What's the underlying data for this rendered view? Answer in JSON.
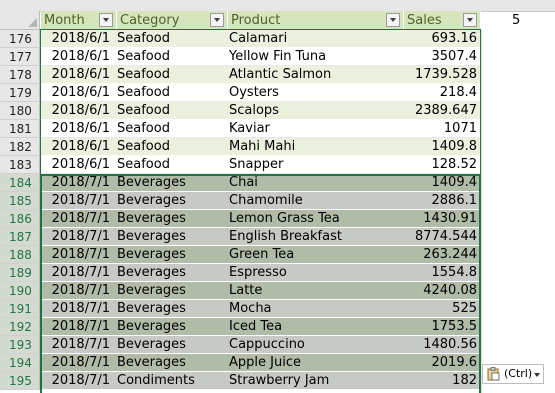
{
  "headers": [
    {
      "label": "Month"
    },
    {
      "label": "Category"
    },
    {
      "label": "Product"
    },
    {
      "label": "Sales"
    }
  ],
  "outside_cell": "5",
  "paste_options_label": "(Ctrl)",
  "rows": [
    {
      "num": "176",
      "month": "2018/6/1",
      "category": "Seafood",
      "product": "Calamari",
      "sales": "693.16",
      "style": "light"
    },
    {
      "num": "177",
      "month": "2018/6/1",
      "category": "Seafood",
      "product": "Yellow Fin Tuna",
      "sales": "3507.4",
      "style": "white"
    },
    {
      "num": "178",
      "month": "2018/6/1",
      "category": "Seafood",
      "product": "Atlantic Salmon",
      "sales": "1739.528",
      "style": "light"
    },
    {
      "num": "179",
      "month": "2018/6/1",
      "category": "Seafood",
      "product": "Oysters",
      "sales": "218.4",
      "style": "white"
    },
    {
      "num": "180",
      "month": "2018/6/1",
      "category": "Seafood",
      "product": "Scalops",
      "sales": "2389.647",
      "style": "light"
    },
    {
      "num": "181",
      "month": "2018/6/1",
      "category": "Seafood",
      "product": "Kaviar",
      "sales": "1071",
      "style": "white"
    },
    {
      "num": "182",
      "month": "2018/6/1",
      "category": "Seafood",
      "product": "Mahi Mahi",
      "sales": "1409.8",
      "style": "light"
    },
    {
      "num": "183",
      "month": "2018/6/1",
      "category": "Seafood",
      "product": "Snapper",
      "sales": "128.52",
      "style": "white"
    },
    {
      "num": "184",
      "month": "2018/7/1",
      "category": "Beverages",
      "product": "Chai",
      "sales": "1409.4",
      "style": "sdark"
    },
    {
      "num": "185",
      "month": "2018/7/1",
      "category": "Beverages",
      "product": "Chamomile",
      "sales": "2886.1",
      "style": "slight"
    },
    {
      "num": "186",
      "month": "2018/7/1",
      "category": "Beverages",
      "product": "Lemon Grass Tea",
      "sales": "1430.91",
      "style": "sdark"
    },
    {
      "num": "187",
      "month": "2018/7/1",
      "category": "Beverages",
      "product": "English Breakfast",
      "sales": "8774.544",
      "style": "slight"
    },
    {
      "num": "188",
      "month": "2018/7/1",
      "category": "Beverages",
      "product": "Green Tea",
      "sales": "263.244",
      "style": "sdark"
    },
    {
      "num": "189",
      "month": "2018/7/1",
      "category": "Beverages",
      "product": "Espresso",
      "sales": "1554.8",
      "style": "slight"
    },
    {
      "num": "190",
      "month": "2018/7/1",
      "category": "Beverages",
      "product": "Latte",
      "sales": "4240.08",
      "style": "sdark"
    },
    {
      "num": "191",
      "month": "2018/7/1",
      "category": "Beverages",
      "product": "Mocha",
      "sales": "525",
      "style": "slight"
    },
    {
      "num": "192",
      "month": "2018/7/1",
      "category": "Beverages",
      "product": "Iced Tea",
      "sales": "1753.5",
      "style": "sdark"
    },
    {
      "num": "193",
      "month": "2018/7/1",
      "category": "Beverages",
      "product": "Cappuccino",
      "sales": "1480.56",
      "style": "slight"
    },
    {
      "num": "194",
      "month": "2018/7/1",
      "category": "Beverages",
      "product": "Apple Juice",
      "sales": "2019.6",
      "style": "sdark"
    },
    {
      "num": "195",
      "month": "2018/7/1",
      "category": "Condiments",
      "product": "Strawberry Jam",
      "sales": "182",
      "style": "slight"
    }
  ],
  "colors": {
    "header_fill": "#d8e4bc",
    "header_text": "#4f6228",
    "band_light": "#ebf1de",
    "selection_dark": "#b0bca8",
    "selection_light": "#c6c9c4",
    "selection_border": "#217346"
  }
}
